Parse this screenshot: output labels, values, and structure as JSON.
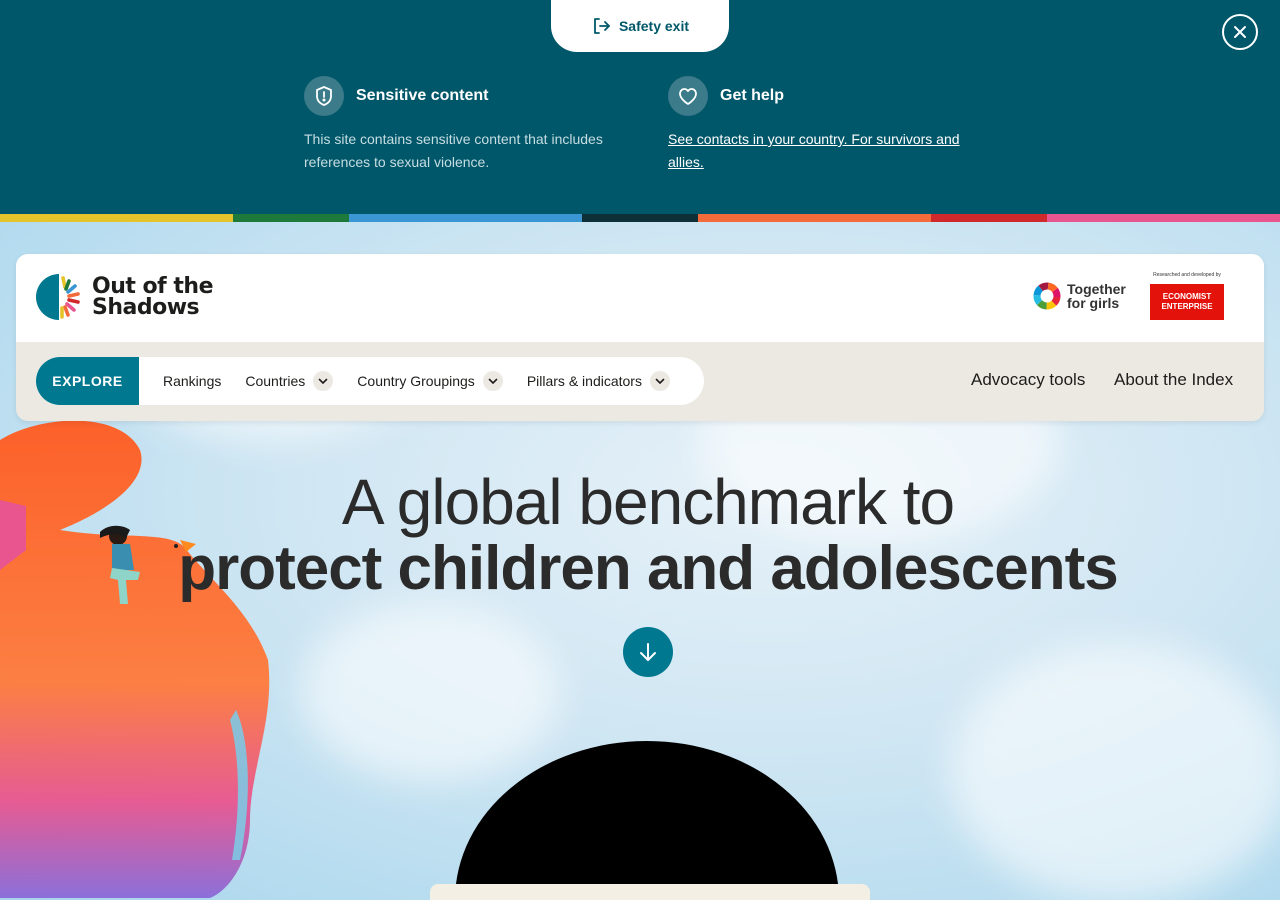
{
  "banner": {
    "safety_exit_label": "Safety exit",
    "sensitive": {
      "title": "Sensitive content",
      "text": "This site contains sensitive content that includes references to sexual violence."
    },
    "help": {
      "title": "Get help",
      "link": "See contacts in your country. For survivors and allies."
    }
  },
  "strip_colors": [
    "#e5c42b",
    "#1e7a3b",
    "#3a97d4",
    "#0e2f35",
    "#f36b3b",
    "#d0292c",
    "#e8558f"
  ],
  "header": {
    "logo_line1": "Out of the",
    "logo_line2": "Shadows",
    "partner_tfg_line1": "Together",
    "partner_tfg_line2": "for girls",
    "partner_ee_caption": "Researched and developed by",
    "partner_ee_line1": "ECONOMIST",
    "partner_ee_line2": "ENTERPRISE"
  },
  "nav": {
    "explore": "EXPLORE",
    "items": [
      "Rankings",
      "Countries",
      "Country Groupings",
      "Pillars & indicators"
    ],
    "right": [
      "Advocacy tools",
      "About the Index"
    ]
  },
  "hero": {
    "line1": "A global benchmark to",
    "line2": "protect children and adolescents"
  },
  "colors": {
    "banner_bg": "#00576a",
    "accent": "#00788f",
    "nav_bar_bg": "#ece9e3"
  }
}
